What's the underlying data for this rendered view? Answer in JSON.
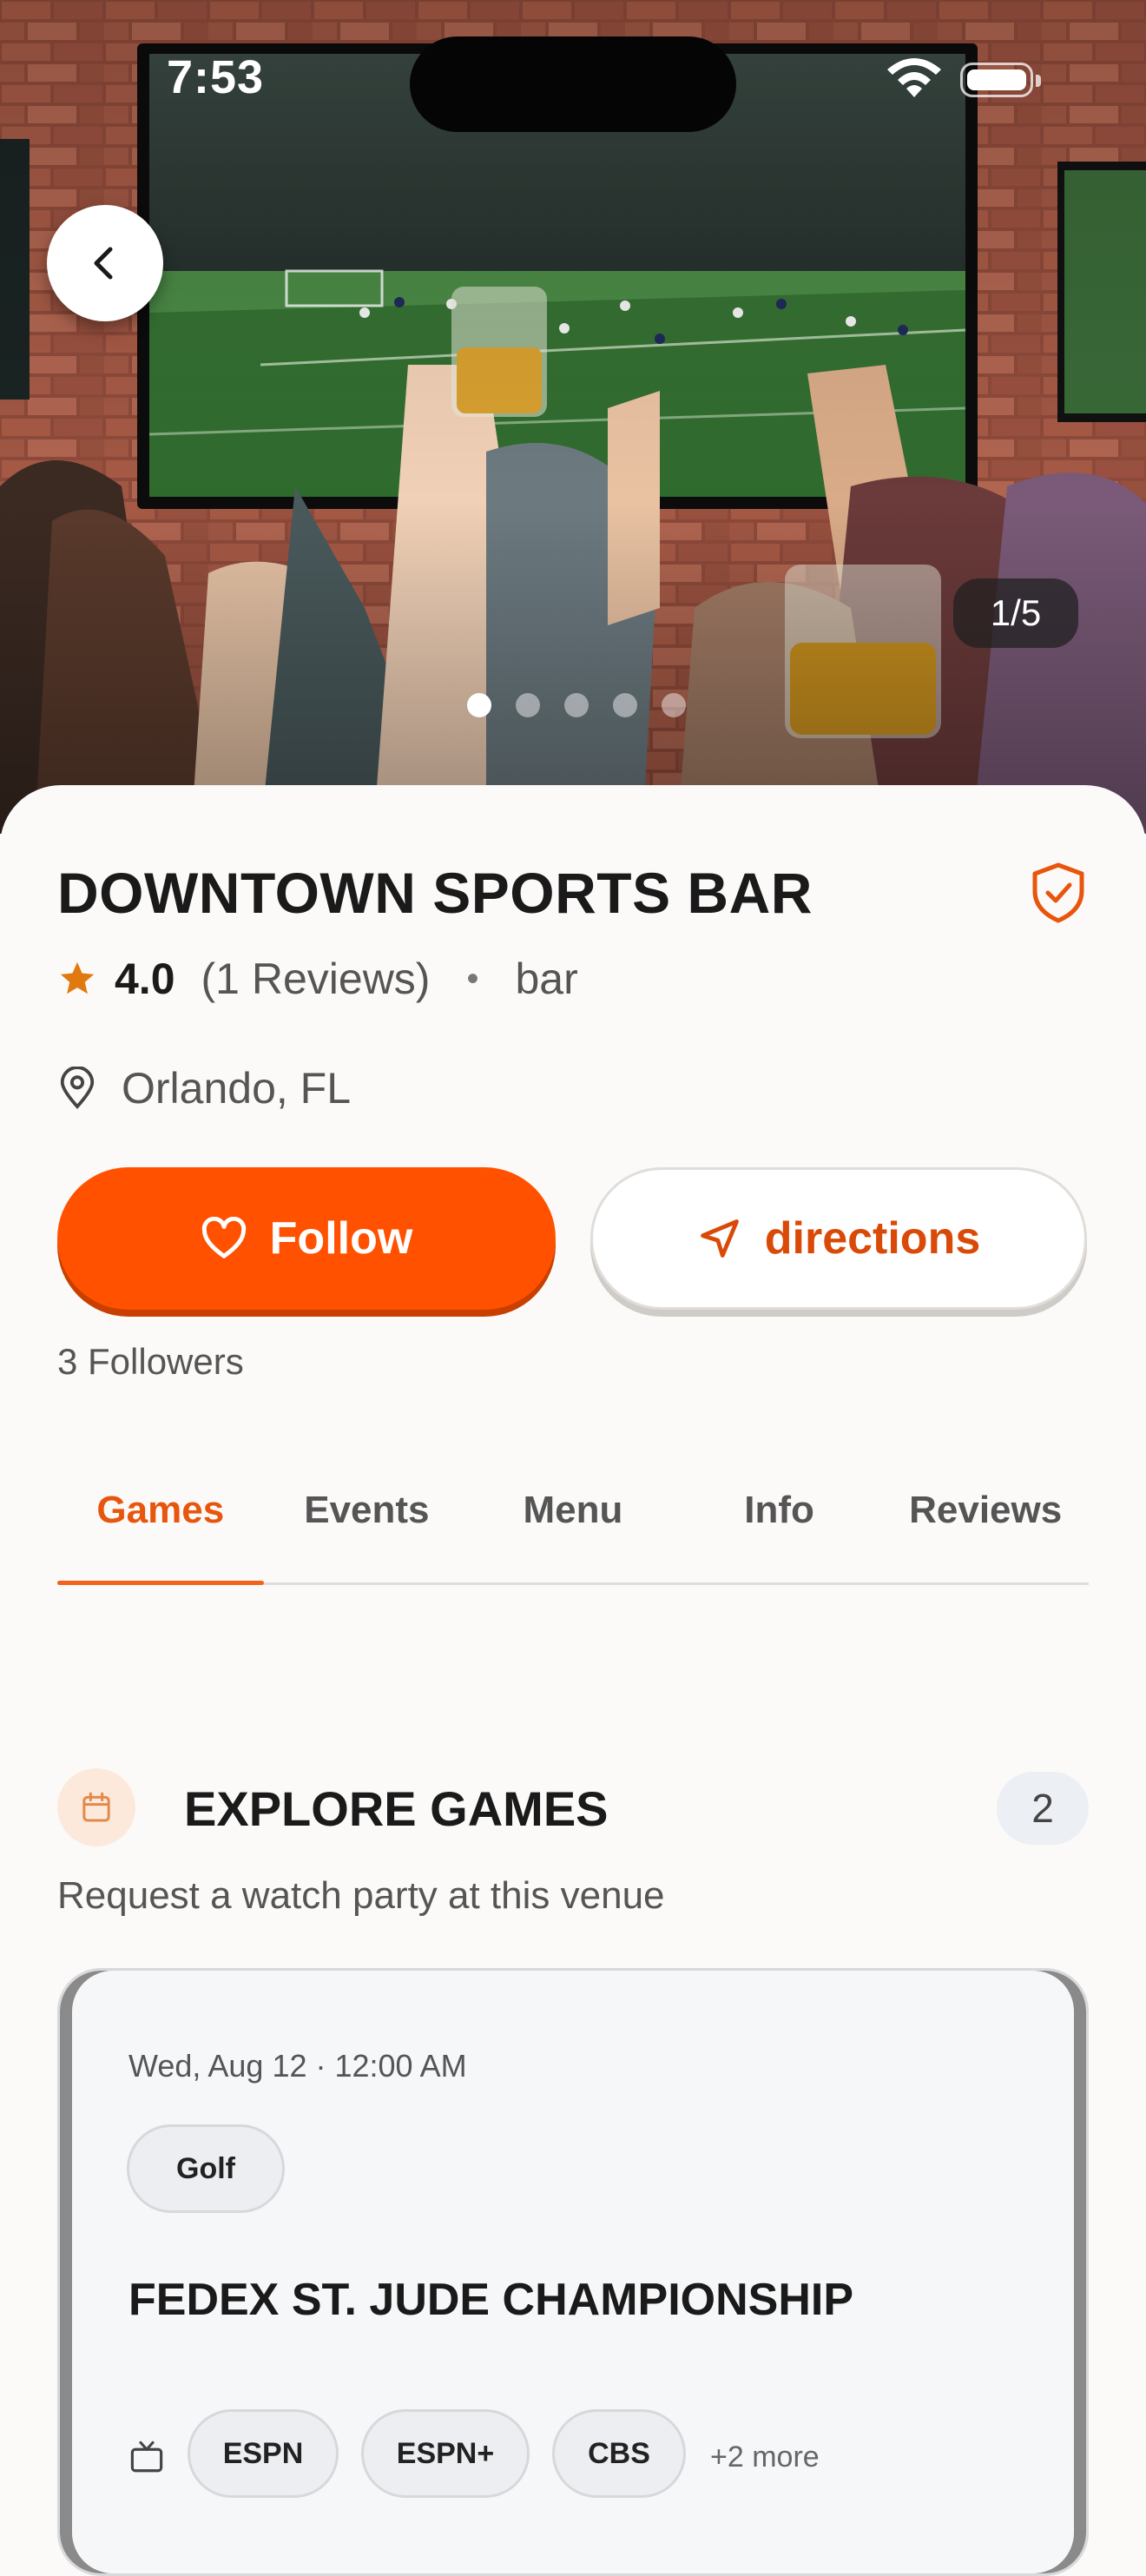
{
  "status_bar": {
    "time": "7:53"
  },
  "gallery": {
    "counter": "1/5",
    "total_images": 5,
    "active_index": 0
  },
  "venue": {
    "name": "DOWNTOWN SPORTS BAR",
    "rating": "4.0",
    "reviews": "(1 Reviews)",
    "separator": "•",
    "category": "bar",
    "location": "Orlando, FL",
    "followers": "3 Followers"
  },
  "actions": {
    "follow_label": "Follow",
    "directions_label": "directions"
  },
  "tabs": [
    {
      "label": "Games",
      "active": true
    },
    {
      "label": "Events",
      "active": false
    },
    {
      "label": "Menu",
      "active": false
    },
    {
      "label": "Info",
      "active": false
    },
    {
      "label": "Reviews",
      "active": false
    }
  ],
  "section": {
    "title": "EXPLORE GAMES",
    "count": "2",
    "subtitle": "Request a watch party at this venue"
  },
  "game": {
    "date": "Wed, Aug 12 · 12:00 AM",
    "sport": "Golf",
    "title": "FEDEX ST. JUDE CHAMPIONSHIP",
    "channels": [
      "ESPN",
      "ESPN+",
      "CBS"
    ],
    "more_channels": "+2 more"
  },
  "colors": {
    "accent": "#ff5100",
    "accent_text": "#e8550d",
    "background": "#fbfaf8",
    "star": "#e07a10"
  },
  "icons": [
    "back-chevron-icon",
    "verified-shield-icon",
    "star-icon",
    "location-pin-icon",
    "heart-icon",
    "navigation-arrow-icon",
    "calendar-icon",
    "tv-icon",
    "wifi-icon",
    "battery-icon"
  ]
}
